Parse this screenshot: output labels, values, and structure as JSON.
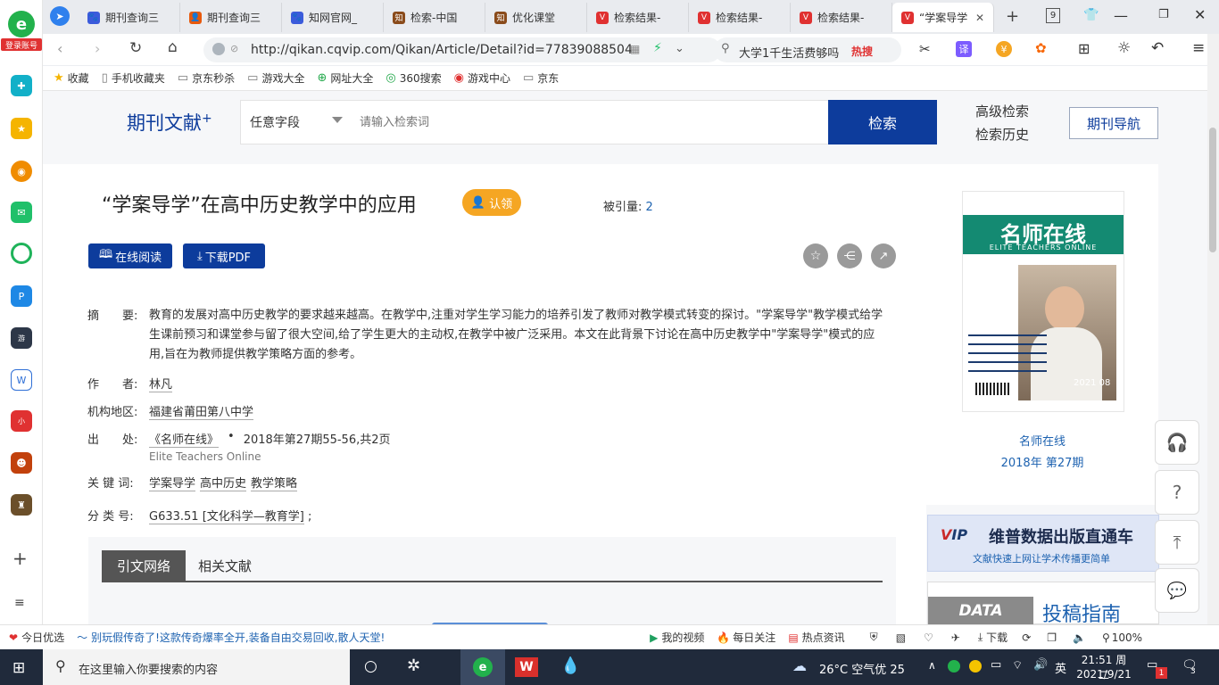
{
  "browser": {
    "sidebar_login": "登录账号",
    "tabs": [
      {
        "label": "期刊查询三",
        "color": "#3b5bdb",
        "glyph": "🐾"
      },
      {
        "label": "期刊查询三",
        "color": "#e8590c",
        "glyph": "👤"
      },
      {
        "label": "知网官网_",
        "color": "#3b5bdb",
        "glyph": "🐾"
      },
      {
        "label": "检索-中国",
        "color": "#8a4b1b",
        "glyph": "知"
      },
      {
        "label": "优化课堂",
        "color": "#8a4b1b",
        "glyph": "知"
      },
      {
        "label": "检索结果-",
        "color": "#e03131",
        "glyph": "V"
      },
      {
        "label": "检索结果-",
        "color": "#e03131",
        "glyph": "V"
      },
      {
        "label": "检索结果-",
        "color": "#e03131",
        "glyph": "V"
      },
      {
        "label": "“学案导学",
        "color": "#e03131",
        "glyph": "V"
      }
    ],
    "tab_count": "9",
    "url": "http://qikan.cqvip.com/Qikan/Article/Detail?id=77839088504",
    "search_suggestion": "大学1千生活费够吗",
    "search_hot": "热搜",
    "translate_label": "译",
    "bookmarks": [
      {
        "label": "收藏",
        "icon": "star-icon"
      },
      {
        "label": "手机收藏夹",
        "icon": "phone-icon"
      },
      {
        "label": "京东秒杀",
        "icon": "page-icon"
      },
      {
        "label": "游戏大全",
        "icon": "page-icon"
      },
      {
        "label": "网址大全",
        "icon": "plus-circle-icon"
      },
      {
        "label": "360搜索",
        "icon": "search-360-icon"
      },
      {
        "label": "游戏中心",
        "icon": "game-icon"
      },
      {
        "label": "京东",
        "icon": "page-icon"
      }
    ]
  },
  "site": {
    "logo": "期刊文献",
    "logo_sup": "+",
    "field_select": "任意字段",
    "search_placeholder": "请输入检索词",
    "search_button": "检索",
    "advanced_search": "高级检索",
    "search_history": "检索历史",
    "journal_nav": "期刊导航"
  },
  "article": {
    "title": "“学案导学”在高中历史教学中的应用",
    "claim_label": "认领",
    "cited_label": "被引量:",
    "cited_count": "2",
    "read_online": "在线阅读",
    "download_pdf": "下载PDF",
    "abstract_label": "摘　　要:",
    "abstract": "教育的发展对高中历史教学的要求越来越高。在教学中,注重对学生学习能力的培养引发了教师对教学模式转变的探讨。\"学案导学\"教学模式给学生课前预习和课堂参与留了很大空间,给了学生更大的主动权,在教学中被广泛采用。本文在此背景下讨论在高中历史教学中\"学案导学\"模式的应用,旨在为教师提供教学策略方面的参考。",
    "author_label": "作　　者:",
    "author": "林凡",
    "org_label": "机构地区:",
    "org": "福建省莆田第八中学",
    "source_label": "出　　处:",
    "source_journal": "《名师在线》",
    "source_dot": "•",
    "source_detail": "2018年第27期55-56,共2页",
    "source_en": "Elite Teachers Online",
    "keywords_label": "关 键 词:",
    "keywords": [
      "学案导学",
      "高中历史",
      "教学策略"
    ],
    "class_label": "分 类 号:",
    "class_code": "G633.51 [文化科学—教育学]",
    "class_sep": ";",
    "tab_citation": "引文网络",
    "tab_related": "相关文献"
  },
  "cover": {
    "brand_cn": "名师在线",
    "brand_en": "ELITE TEACHERS ONLINE",
    "issue_on_cover": "2021 08",
    "journal_name": "名师在线",
    "issue": "2018年 第27期"
  },
  "ads": {
    "vip_title": "维普数据出版直通车",
    "vip_sub": "文献快速上网让学术传播更简单",
    "data_label": "DATA",
    "guide_title": "投稿指南"
  },
  "status": {
    "today": "今日优选",
    "news": "别玩假传奇了!这款传奇爆率全开,装备自由交易回收,散人天堂!",
    "my_video": "我的视频",
    "daily": "每日关注",
    "hot_news": "热点资讯",
    "download": "下载",
    "zoom": "100%"
  },
  "taskbar": {
    "search_placeholder": "在这里输入你要搜索的内容",
    "weather": "26°C 空气优 25",
    "ime": "英",
    "time": "21:51 周二",
    "date": "2021/9/21",
    "notif_badge": "1",
    "msg_badge": "3"
  },
  "colors": {
    "brand_blue": "#0d3c9c",
    "link_blue": "#1d62b0",
    "claim_orange": "#f5a623",
    "taskbar": "#202a3b"
  }
}
